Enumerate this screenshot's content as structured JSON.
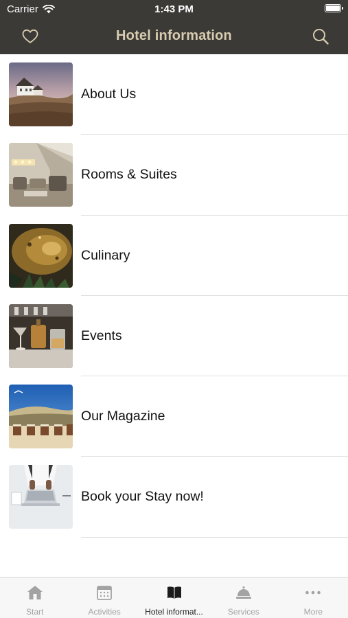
{
  "status_bar": {
    "carrier": "Carrier",
    "time": "1:43 PM"
  },
  "nav": {
    "title": "Hotel information",
    "left_icon": "heart-icon",
    "right_icon": "search-icon",
    "title_color": "#d9ccb0",
    "bar_color": "#3b3a37"
  },
  "list": {
    "items": [
      {
        "label": "About Us"
      },
      {
        "label": "Rooms & Suites"
      },
      {
        "label": "Culinary"
      },
      {
        "label": "Events"
      },
      {
        "label": "Our Magazine"
      },
      {
        "label": "Book your Stay now!"
      }
    ]
  },
  "tab_bar": {
    "tabs": [
      {
        "label": "Start",
        "icon": "home-icon"
      },
      {
        "label": "Activities",
        "icon": "calendar-icon"
      },
      {
        "label": "Hotel informat...",
        "icon": "book-icon"
      },
      {
        "label": "Services",
        "icon": "service-bell-icon"
      },
      {
        "label": "More",
        "icon": "more-dots-icon"
      }
    ],
    "active_index": 2
  }
}
